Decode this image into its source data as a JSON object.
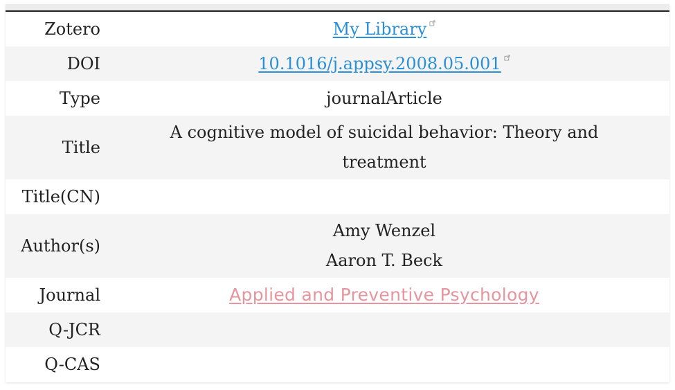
{
  "rows": {
    "zotero": {
      "label": "Zotero",
      "link_text": "My Library"
    },
    "doi": {
      "label": "DOI",
      "link_text": "10.1016/j.appsy.2008.05.001"
    },
    "type": {
      "label": "Type",
      "value": "journalArticle"
    },
    "title": {
      "label": "Title",
      "value_line1": "A cognitive model of suicidal behavior: Theory and",
      "value_line2": "treatment"
    },
    "title_cn": {
      "label": "Title(CN)",
      "value": ""
    },
    "authors": {
      "label": "Author(s)",
      "names": [
        "Amy Wenzel",
        "Aaron T. Beck"
      ]
    },
    "journal": {
      "label": "Journal",
      "link_text": "Applied and Preventive Psychology"
    },
    "q_jcr": {
      "label": "Q-JCR",
      "value": ""
    },
    "q_cas": {
      "label": "Q-CAS",
      "value": ""
    }
  },
  "icons": {
    "external_link": "external-link-icon"
  },
  "colors": {
    "link": "#2a8fd6",
    "journal_link": "#e6959e",
    "text": "#222222",
    "alt_row": "#f4f4f4"
  }
}
